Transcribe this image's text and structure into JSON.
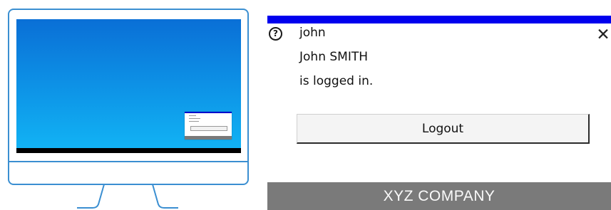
{
  "illustration": {
    "monitor_icon": "desktop-monitor-icon",
    "frame_color": "#3b8fd1"
  },
  "notification": {
    "accent_color": "#0000ee",
    "help_icon": "help-circle-icon",
    "help_glyph": "?",
    "close_icon": "close-x-icon",
    "close_glyph": "✕",
    "username": "john",
    "full_name": "John SMITH",
    "status_text": "is logged in.",
    "logout_label": "Logout",
    "company_name": "XYZ COMPANY"
  }
}
